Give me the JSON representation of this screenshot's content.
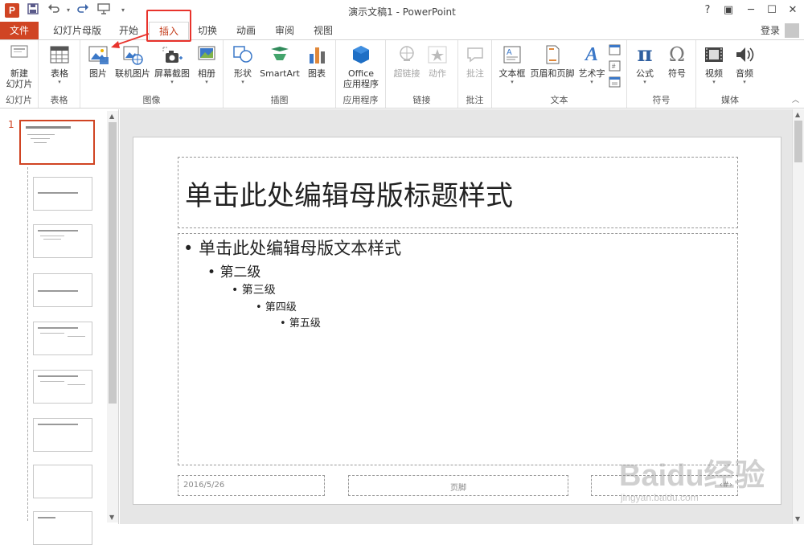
{
  "app": {
    "logo_letter": "P",
    "window_title": "演示文稿1 - PowerPoint",
    "help": "?",
    "ribbon_display": "▣",
    "minimize": "─",
    "maximize": "☐",
    "close": "✕",
    "login": "登录"
  },
  "quick_access": {
    "save_icon": "save-icon",
    "undo_icon": "undo-icon",
    "redo_icon": "redo-icon",
    "present_icon": "present-icon"
  },
  "tabs": {
    "file": "文件",
    "slide_master": "幻灯片母版",
    "home": "开始",
    "insert": "插入",
    "transitions": "切换",
    "animations": "动画",
    "review": "审阅",
    "view": "视图"
  },
  "ribbon": {
    "groups": {
      "slides": "幻灯片",
      "tables": "表格",
      "images": "图像",
      "illustrations": "插图",
      "apps": "应用程序",
      "links": "链接",
      "comments": "批注",
      "text": "文本",
      "symbols": "符号",
      "media": "媒体"
    },
    "buttons": {
      "new_slide_1": "新建",
      "new_slide_2": "幻灯片",
      "table": "表格",
      "pictures": "图片",
      "online_pictures": "联机图片",
      "screenshot": "屏幕截图",
      "photo_album": "相册",
      "shapes": "形状",
      "smartart": "SmartArt",
      "chart": "图表",
      "office_apps_1": "Office",
      "office_apps_2": "应用程序",
      "hyperlink": "超链接",
      "action": "动作",
      "comment": "批注",
      "text_box": "文本框",
      "header_footer": "页眉和页脚",
      "wordart": "艺术字",
      "equation": "公式",
      "symbol": "符号",
      "video": "视频",
      "audio": "音频",
      "equation_glyph": "π",
      "symbol_glyph": "Ω",
      "wordart_glyph": "A"
    }
  },
  "thumbnails": {
    "selected_number": "1"
  },
  "slide": {
    "title": "单击此处编辑母版标题样式",
    "body": {
      "level1": "单击此处编辑母版文本样式",
      "level2": "第二级",
      "level3": "第三级",
      "level4": "第四级",
      "level5": "第五级"
    },
    "bullet": "•",
    "footer_date": "2016/5/26",
    "footer_center": "页脚",
    "footer_number": "‹#›"
  },
  "watermark": {
    "brand": "Baidu经验",
    "url": "jingyan.baidu.com"
  },
  "colors": {
    "accent": "#d04423",
    "highlight_box": "#e8332c"
  }
}
